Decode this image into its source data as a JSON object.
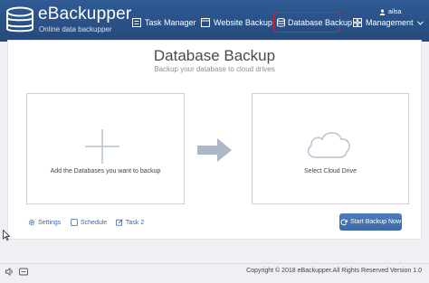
{
  "brand": {
    "name": "eBackupper",
    "tagline": "Online data backupper"
  },
  "user": {
    "name": "ailsa"
  },
  "nav": {
    "items": [
      {
        "label": "Task Manager",
        "icon": "task-manager-icon"
      },
      {
        "label": "Website Backup",
        "icon": "website-icon"
      },
      {
        "label": "Database Backup",
        "icon": "database-icon",
        "selected": true
      },
      {
        "label": "Management",
        "icon": "grid-icon"
      }
    ]
  },
  "main": {
    "title": "Database Backup",
    "subtitle": "Backup your database to cloud drives",
    "source_label": "Add the Databases you want to backup",
    "dest_label": "Select Cloud Drive"
  },
  "options": {
    "settings": "Settings",
    "schedule": "Schedule",
    "task": "Task 2"
  },
  "actions": {
    "start": "Start Backup Now"
  },
  "footer": {
    "copyright": "Copyright © 2018 eBackupper.All Rights Reserved Version 1.0"
  },
  "colors": {
    "header": "#2f5a93",
    "accent": "#3b6aa6",
    "highlight_border": "#d9252a",
    "arrow": "#aab8c8"
  }
}
